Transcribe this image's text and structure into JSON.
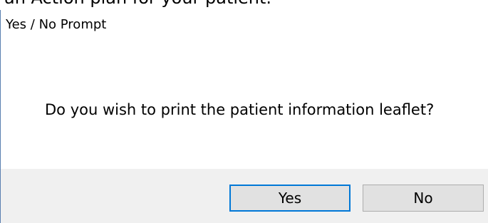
{
  "background_text": "an Action plan for your patient.",
  "dialog": {
    "title": "Yes / No Prompt",
    "message": "Do you wish to print the patient information leaflet?",
    "buttons": {
      "yes_label": "Yes",
      "no_label": "No"
    },
    "default_button": "Yes"
  },
  "colors": {
    "accent": "#0078d7",
    "button_bar": "#f0f0f0",
    "button_face": "#e1e1e1"
  }
}
